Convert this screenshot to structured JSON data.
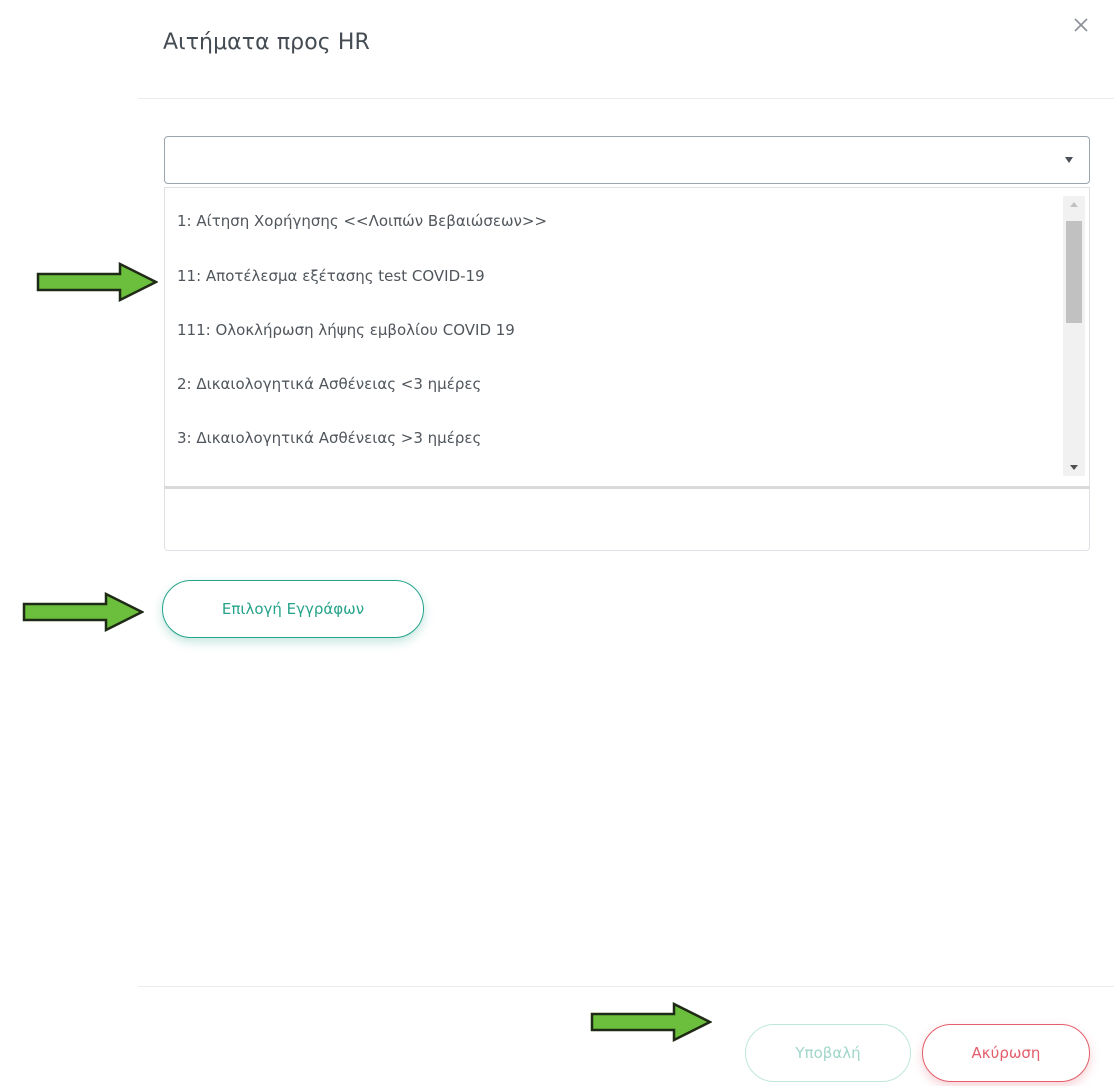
{
  "modal": {
    "title": "Αιτήματα προς HR",
    "close_icon": "close-icon"
  },
  "select": {
    "value": "",
    "caret_icon": "caret-down-icon",
    "options": [
      "1: Αίτηση Χορήγησης <<Λοιπών Βεβαιώσεων>>",
      "11: Αποτέλεσμα εξέτασης test COVID-19",
      "111: Ολοκλήρωση λήψης εμβολίου COVID 19",
      "2: Δικαιολογητικά Ασθένειας <3 ημέρες",
      "3: Δικαιολογητικά Ασθένειας >3 ημέρες"
    ]
  },
  "buttons": {
    "select_documents": "Επιλογή Εγγράφων",
    "submit": "Υποβαλή",
    "cancel": "Ακύρωση"
  },
  "annotations": {
    "arrow_icon": "green-arrow-icon",
    "arrow_color": "#6cbf3c"
  },
  "colors": {
    "accent_teal": "#26a38a",
    "cancel_red": "#e35d6a",
    "submit_disabled": "#9fd6c9"
  }
}
